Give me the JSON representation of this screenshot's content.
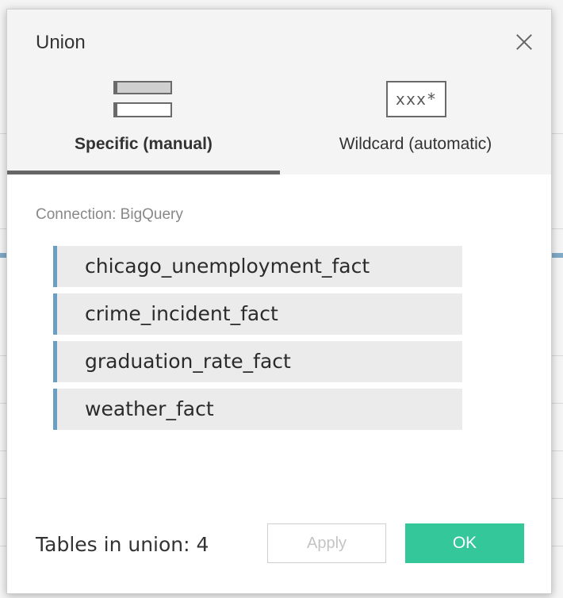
{
  "dialog": {
    "title": "Union",
    "tabs": [
      {
        "label": "Specific (manual)",
        "icon": "specific-list-icon",
        "active": true
      },
      {
        "label": "Wildcard (automatic)",
        "icon": "wildcard-icon",
        "icon_text": "xxx*",
        "active": false
      }
    ],
    "connection_label": "Connection: BigQuery",
    "tables": [
      "chicago_unemployment_fact",
      "crime_incident_fact",
      "graduation_rate_fact",
      "weather_fact"
    ],
    "tables_count_label": "Tables in union: 4",
    "buttons": {
      "apply": "Apply",
      "ok": "OK"
    }
  },
  "colors": {
    "accent_ok": "#33c799",
    "table_marker": "#6a9ec3",
    "active_tab_underline": "#666666"
  }
}
